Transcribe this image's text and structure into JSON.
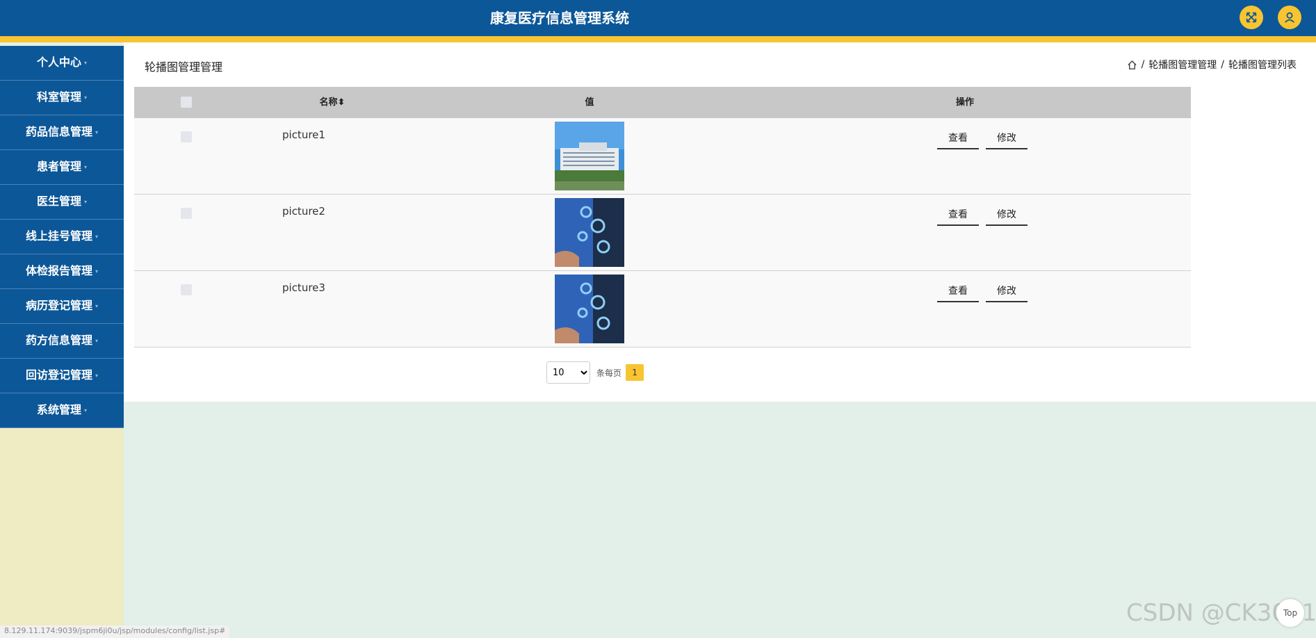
{
  "app": {
    "title": "康复医疗信息管理系统"
  },
  "header": {
    "icons": [
      "fullscreen-icon",
      "user-icon"
    ],
    "accent": "#f8c430",
    "bar_color": "#0c5798"
  },
  "sidebar": {
    "items": [
      {
        "label": "个人中心"
      },
      {
        "label": "科室管理"
      },
      {
        "label": "药品信息管理"
      },
      {
        "label": "患者管理"
      },
      {
        "label": "医生管理"
      },
      {
        "label": "线上挂号管理"
      },
      {
        "label": "体检报告管理"
      },
      {
        "label": "病历登记管理"
      },
      {
        "label": "药方信息管理"
      },
      {
        "label": "回访登记管理"
      },
      {
        "label": "系统管理"
      }
    ]
  },
  "main": {
    "page_title": "轮播图管理管理",
    "breadcrumb": {
      "sep": "/",
      "level1": "轮播图管理管理",
      "level2": "轮播图管理列表"
    }
  },
  "table": {
    "headers": {
      "name": "名称",
      "sort_icon": "⬍",
      "value": "值",
      "actions": "操作"
    },
    "rows": [
      {
        "name": "picture1",
        "image": "hospital-building-photo",
        "view": "查看",
        "edit": "修改"
      },
      {
        "name": "picture2",
        "image": "blue-medical-tech-photo",
        "view": "查看",
        "edit": "修改"
      },
      {
        "name": "picture3",
        "image": "blue-medical-tech-photo",
        "view": "查看",
        "edit": "修改"
      }
    ]
  },
  "pagination": {
    "page_size": "10",
    "page_size_options": [
      "10"
    ],
    "per_page_label": "条每页",
    "current_page": "1"
  },
  "status_bar": {
    "url": "8.129.11.174:9039/jspm6ji0u/jsp/modules/config/list.jsp#"
  },
  "watermark": "CSDN @CK3011",
  "back_to_top": {
    "label": "Top"
  }
}
